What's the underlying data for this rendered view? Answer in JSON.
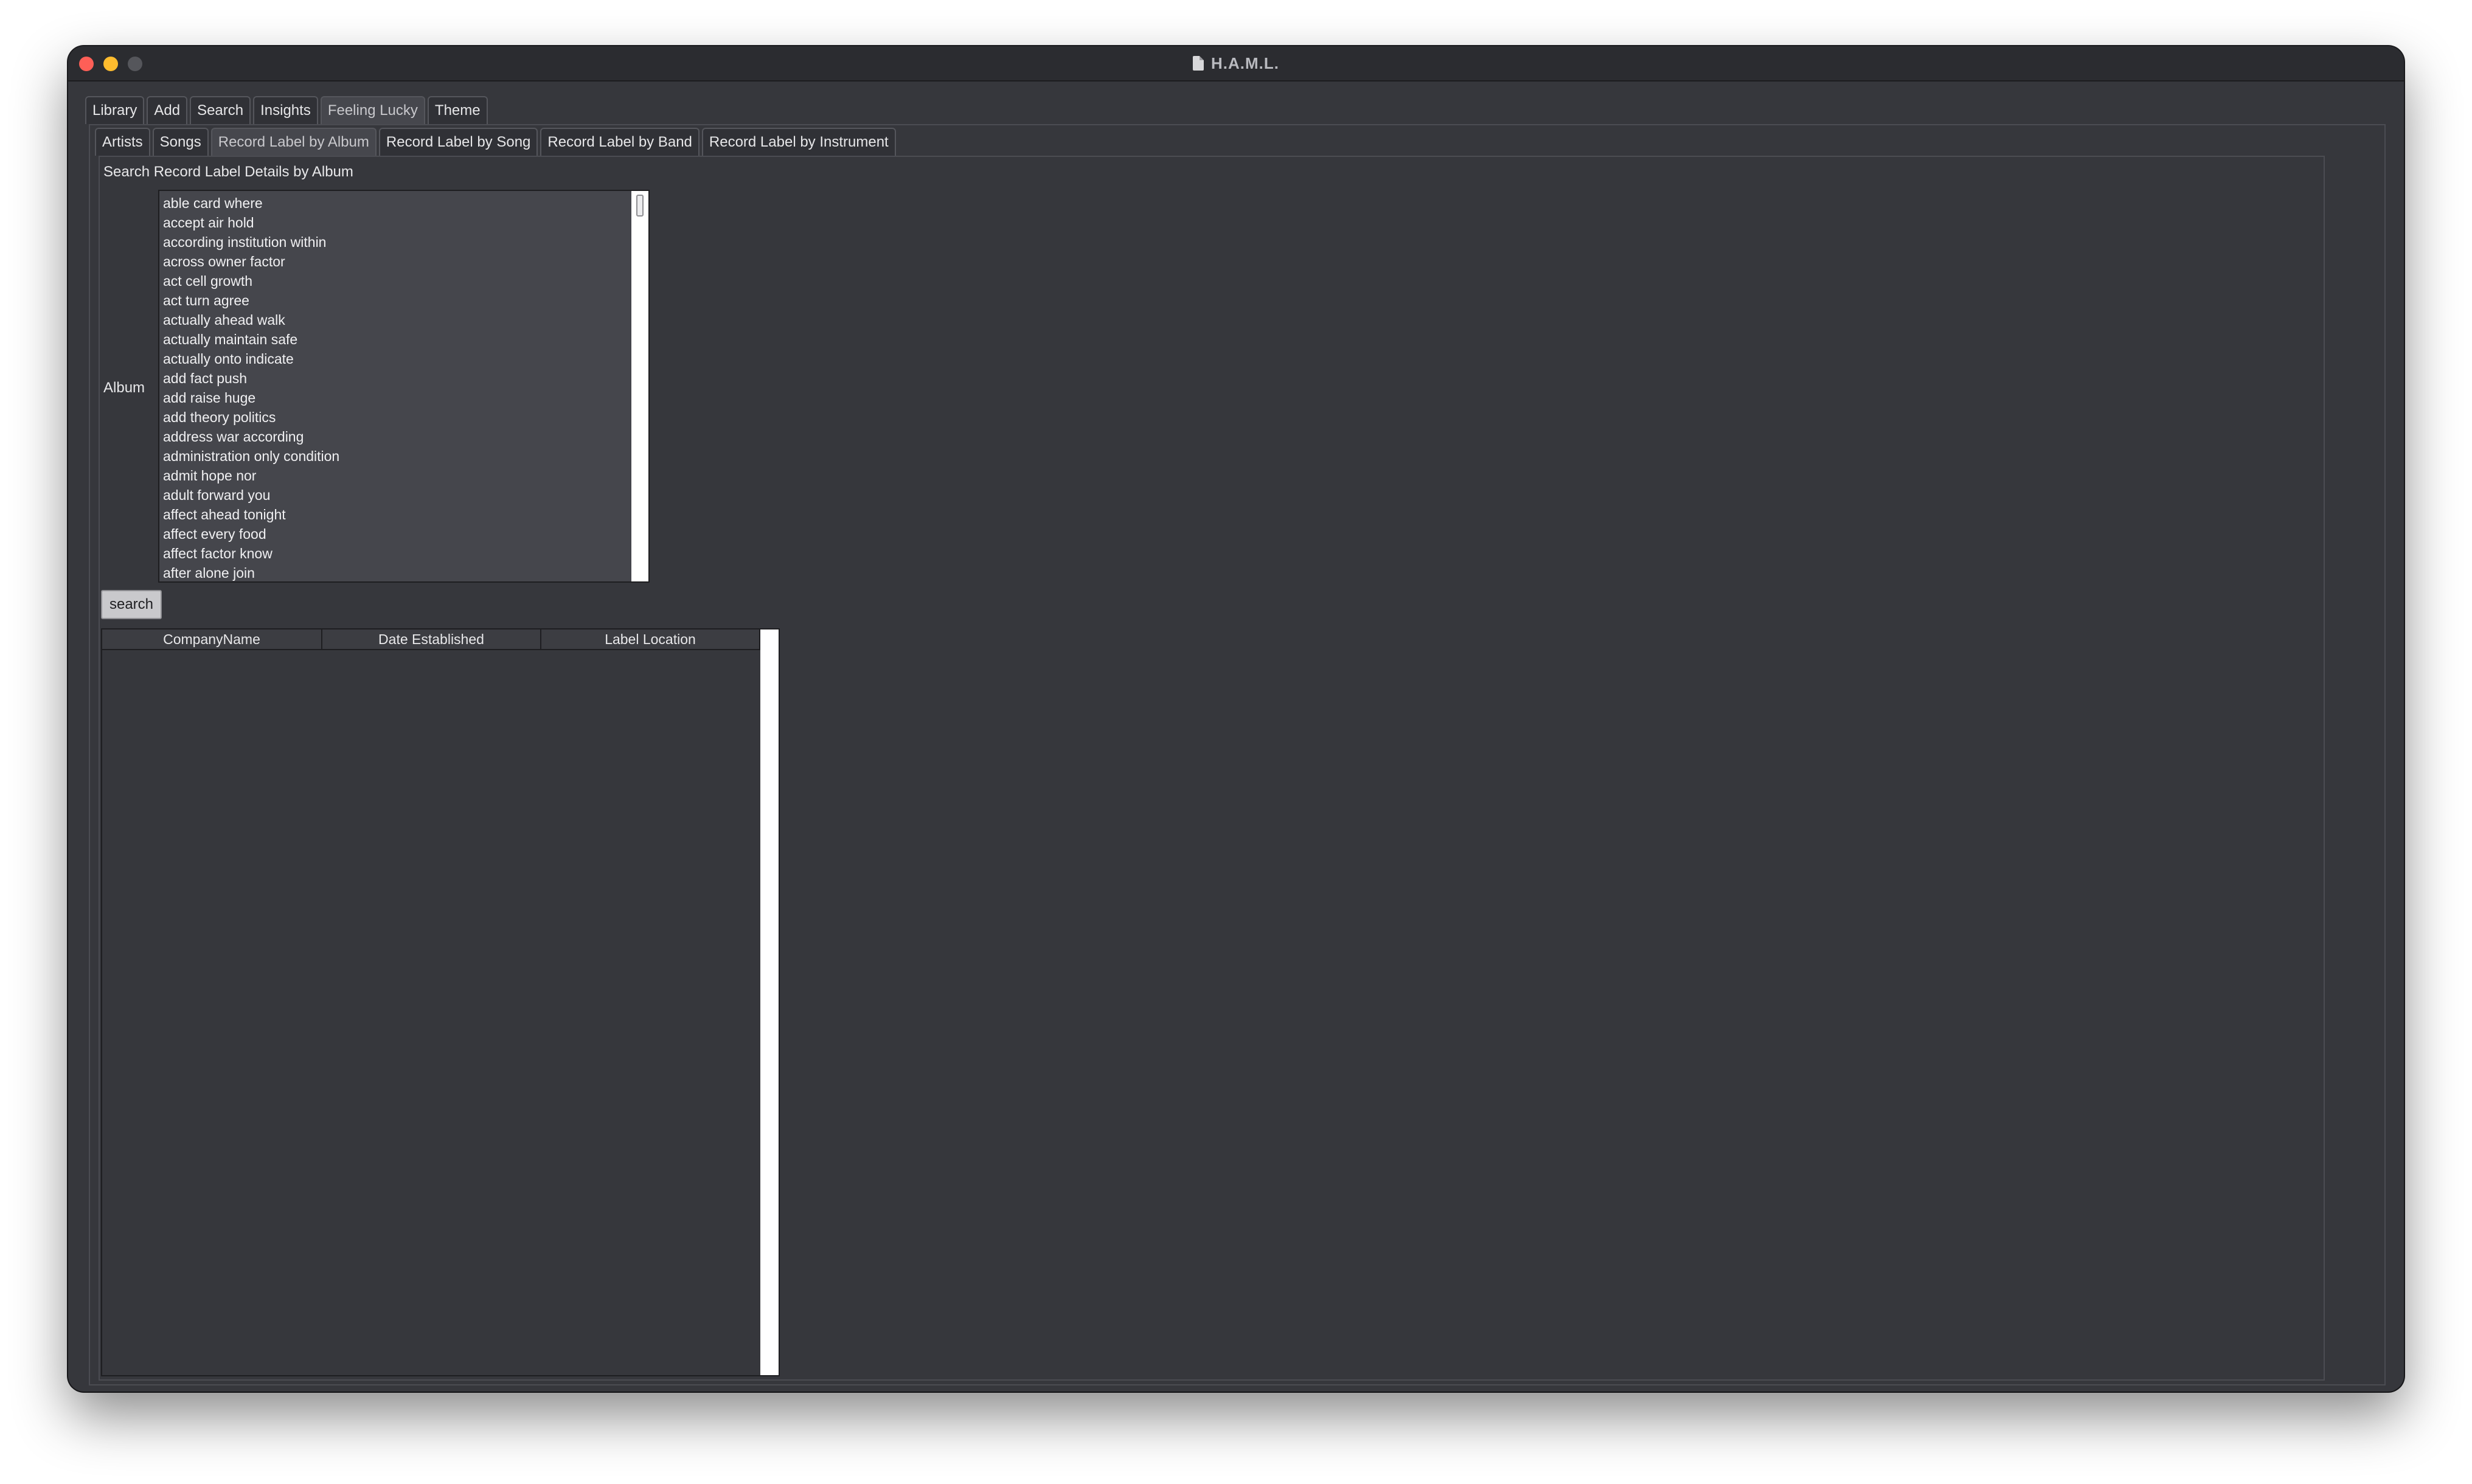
{
  "window": {
    "title": "H.A.M.L."
  },
  "main_tabs": [
    {
      "label": "Library"
    },
    {
      "label": "Add"
    },
    {
      "label": "Search"
    },
    {
      "label": "Insights"
    },
    {
      "label": "Feeling Lucky"
    },
    {
      "label": "Theme"
    }
  ],
  "main_tab_selected": "Search",
  "sub_tabs": [
    {
      "label": "Artists"
    },
    {
      "label": "Songs"
    },
    {
      "label": "Record Label by Album"
    },
    {
      "label": "Record Label by Song"
    },
    {
      "label": "Record Label by Band"
    },
    {
      "label": "Record Label by Instrument"
    }
  ],
  "sub_tab_selected": "Record Label by Album",
  "panel": {
    "heading": "Search Record Label Details by Album",
    "album_label": "Album",
    "search_button": "search"
  },
  "album_list": [
    "able card where",
    "accept air hold",
    "according institution within",
    "across owner factor",
    "act cell growth",
    "act turn agree",
    "actually ahead walk",
    "actually maintain safe",
    "actually onto indicate",
    "add fact push",
    "add raise huge",
    "add theory politics",
    "address war according",
    "administration only condition",
    "admit hope nor",
    "adult forward you",
    "affect ahead tonight",
    "affect every food",
    "affect factor know",
    "after alone join"
  ],
  "results_table": {
    "columns": [
      "CompanyName",
      "Date Established",
      "Label Location"
    ],
    "rows": []
  }
}
